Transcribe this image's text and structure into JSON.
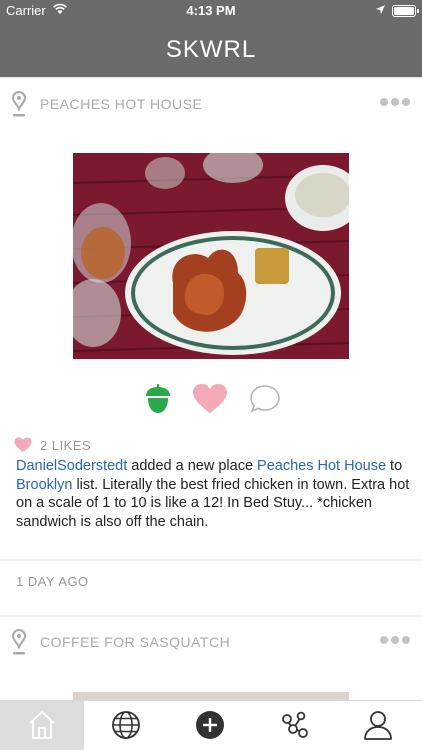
{
  "status_bar": {
    "carrier": "Carrier",
    "time": "4:13 PM"
  },
  "nav": {
    "title": "SKWRL"
  },
  "posts": [
    {
      "place": "PEACHES HOT HOUSE",
      "likes": "2 LIKES",
      "description": {
        "user": "DanielSoderstedt",
        "text1": " added a new place ",
        "place_link": "Peaches Hot House",
        "text2": " to ",
        "list_link": "Brooklyn",
        "text3": " list. Literally the best fried chicken in town.  Extra hot on a scale of 1 to 10 is like a 12!  In Bed Stuy...  *chicken sandwich is also off the chain."
      },
      "time_ago": "1 DAY AGO"
    },
    {
      "place": "COFFEE FOR SASQUATCH"
    }
  ],
  "colors": {
    "bar": "#6b6b6a",
    "acorn": "#2aa84a",
    "heart": "#f3a9b6",
    "link": "#2a66b3"
  },
  "tabs": [
    {
      "icon": "home-icon",
      "active": true
    },
    {
      "icon": "globe-icon",
      "active": false
    },
    {
      "icon": "add-icon",
      "active": false
    },
    {
      "icon": "network-icon",
      "active": false
    },
    {
      "icon": "profile-icon",
      "active": false
    }
  ]
}
